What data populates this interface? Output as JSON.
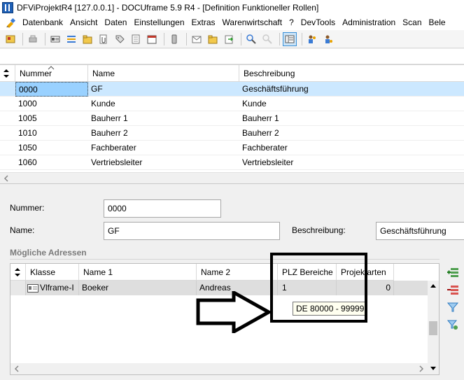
{
  "window": {
    "title": "DFViProjektR4 [127.0.0.1] - DOCUframe 5.9 R4 - [Definition Funktioneller Rollen]"
  },
  "menu": [
    "Datenbank",
    "Ansicht",
    "Daten",
    "Einstellungen",
    "Extras",
    "Warenwirtschaft",
    "?",
    "DevTools",
    "Administration",
    "Scan",
    "Bele"
  ],
  "roles_grid": {
    "columns": [
      "Nummer",
      "Name",
      "Beschreibung"
    ],
    "rows": [
      {
        "nummer": "0000",
        "name": "GF",
        "beschreibung": "Geschäftsführung"
      },
      {
        "nummer": "1000",
        "name": "Kunde",
        "beschreibung": "Kunde"
      },
      {
        "nummer": "1005",
        "name": "Bauherr 1",
        "beschreibung": "Bauherr 1"
      },
      {
        "nummer": "1010",
        "name": "Bauherr 2",
        "beschreibung": "Bauherr 2"
      },
      {
        "nummer": "1050",
        "name": "Fachberater",
        "beschreibung": "Fachberater"
      },
      {
        "nummer": "1060",
        "name": "Vertriebsleiter",
        "beschreibung": "Vertriebsleiter"
      }
    ],
    "selected_index": 0
  },
  "detail": {
    "nummer_label": "Nummer:",
    "nummer_value": "0000",
    "name_label": "Name:",
    "name_value": "GF",
    "beschreibung_label": "Beschreibung:",
    "beschreibung_value": "Geschäftsführung",
    "section_title": "Mögliche Adressen"
  },
  "address_grid": {
    "columns": [
      "Klasse",
      "Name 1",
      "Name 2",
      "PLZ Bereiche",
      "Projektarten"
    ],
    "rows": [
      {
        "klasse": "Vlframe-I",
        "name1": "Boeker",
        "name2": "Andreas",
        "plz": "1",
        "projektarten": "0"
      }
    ]
  },
  "tooltip": "DE 80000 - 99999",
  "colors": {
    "selection": "#cce8ff",
    "row_gray": "#dedede",
    "tooltip_bg": "#fffff0"
  }
}
